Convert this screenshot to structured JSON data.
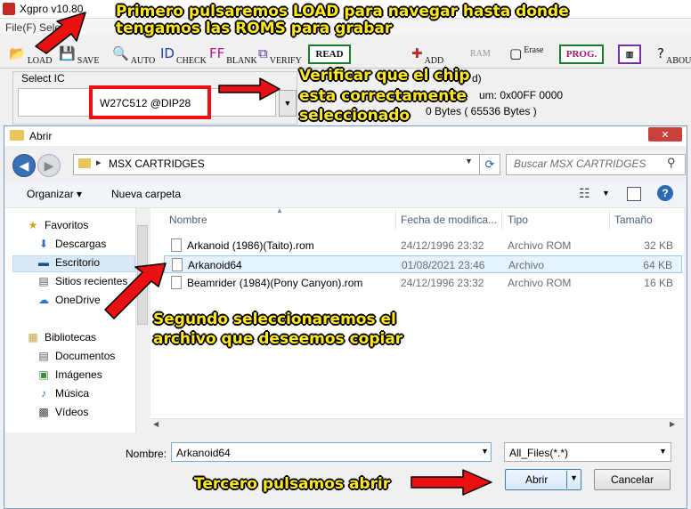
{
  "xgpro": {
    "title": "Xgpro v10.80",
    "menu": "File(F)  Select",
    "toolbar": {
      "load": "LOAD",
      "save": "SAVE",
      "auto": "AUTO",
      "check": "CHECK",
      "blank": "BLANK",
      "verify": "VERIFY",
      "read": "READ",
      "add": "ADD",
      "ram": "RAM",
      "erase": "Erase",
      "prog": "PROG.",
      "about": "ABOU"
    },
    "select_ic_label": "Select IC",
    "ic_value": "W27C512 @DIP28",
    "chip_paren": "d)",
    "chip_checksum": "um:  0x00FF 0000",
    "chip_size": "0 Bytes ( 65536 Bytes )"
  },
  "dialog": {
    "title": "Abrir",
    "close": "✕",
    "path": "MSX CARTRIDGES",
    "search_placeholder": "Buscar MSX CARTRIDGES",
    "organizar": "Organizar ▾",
    "nueva_carpeta": "Nueva carpeta",
    "nav": [
      {
        "label": "Favoritos",
        "icon": "star-icon"
      },
      {
        "label": "Descargas",
        "icon": "downloads-icon"
      },
      {
        "label": "Escritorio",
        "icon": "desktop-icon"
      },
      {
        "label": "Sitios recientes",
        "icon": "recent-icon"
      },
      {
        "label": "OneDrive",
        "icon": "cloud-icon"
      },
      {
        "label": "Bibliotecas",
        "icon": "library-icon"
      },
      {
        "label": "Documentos",
        "icon": "documents-icon"
      },
      {
        "label": "Imágenes",
        "icon": "images-icon"
      },
      {
        "label": "Música",
        "icon": "music-icon"
      },
      {
        "label": "Vídeos",
        "icon": "videos-icon"
      }
    ],
    "columns": [
      "Nombre",
      "Fecha de modifica...",
      "Tipo",
      "Tamaño"
    ],
    "files": [
      {
        "name": "Arkanoid (1986)(Taito).rom",
        "date": "24/12/1996 23:32",
        "type": "Archivo ROM",
        "size": "32 KB",
        "selected": false
      },
      {
        "name": "Arkanoid64",
        "date": "01/08/2021 23:46",
        "type": "Archivo",
        "size": "64 KB",
        "selected": true
      },
      {
        "name": "Beamrider (1984)(Pony Canyon).rom",
        "date": "24/12/1996 23:32",
        "type": "Archivo ROM",
        "size": "16 KB",
        "selected": false
      }
    ],
    "nombre_label": "Nombre:",
    "nombre_value": "Arkanoid64",
    "filter_value": "All_Files(*.*)",
    "open_button": "Abrir",
    "cancel_button": "Cancelar"
  },
  "annotations": {
    "step1_line1": "Primero pulsaremos LOAD para navegar hasta donde",
    "step1_line2": "tengamos las ROMS para grabar",
    "verify_line1": "Verificar que el chip",
    "verify_line2": "esta correctamente",
    "verify_line3": "seleccionado",
    "step2_line1": "Segundo seleccionaremos el",
    "step2_line2": "archivo que deseemos copiar",
    "step3": "Tercero pulsamos abrir"
  },
  "colors": {
    "annotation_text": "#ffe91a",
    "arrow": "#e81010",
    "highlight_box": "#f01010",
    "selection": "#e5f3ff"
  }
}
